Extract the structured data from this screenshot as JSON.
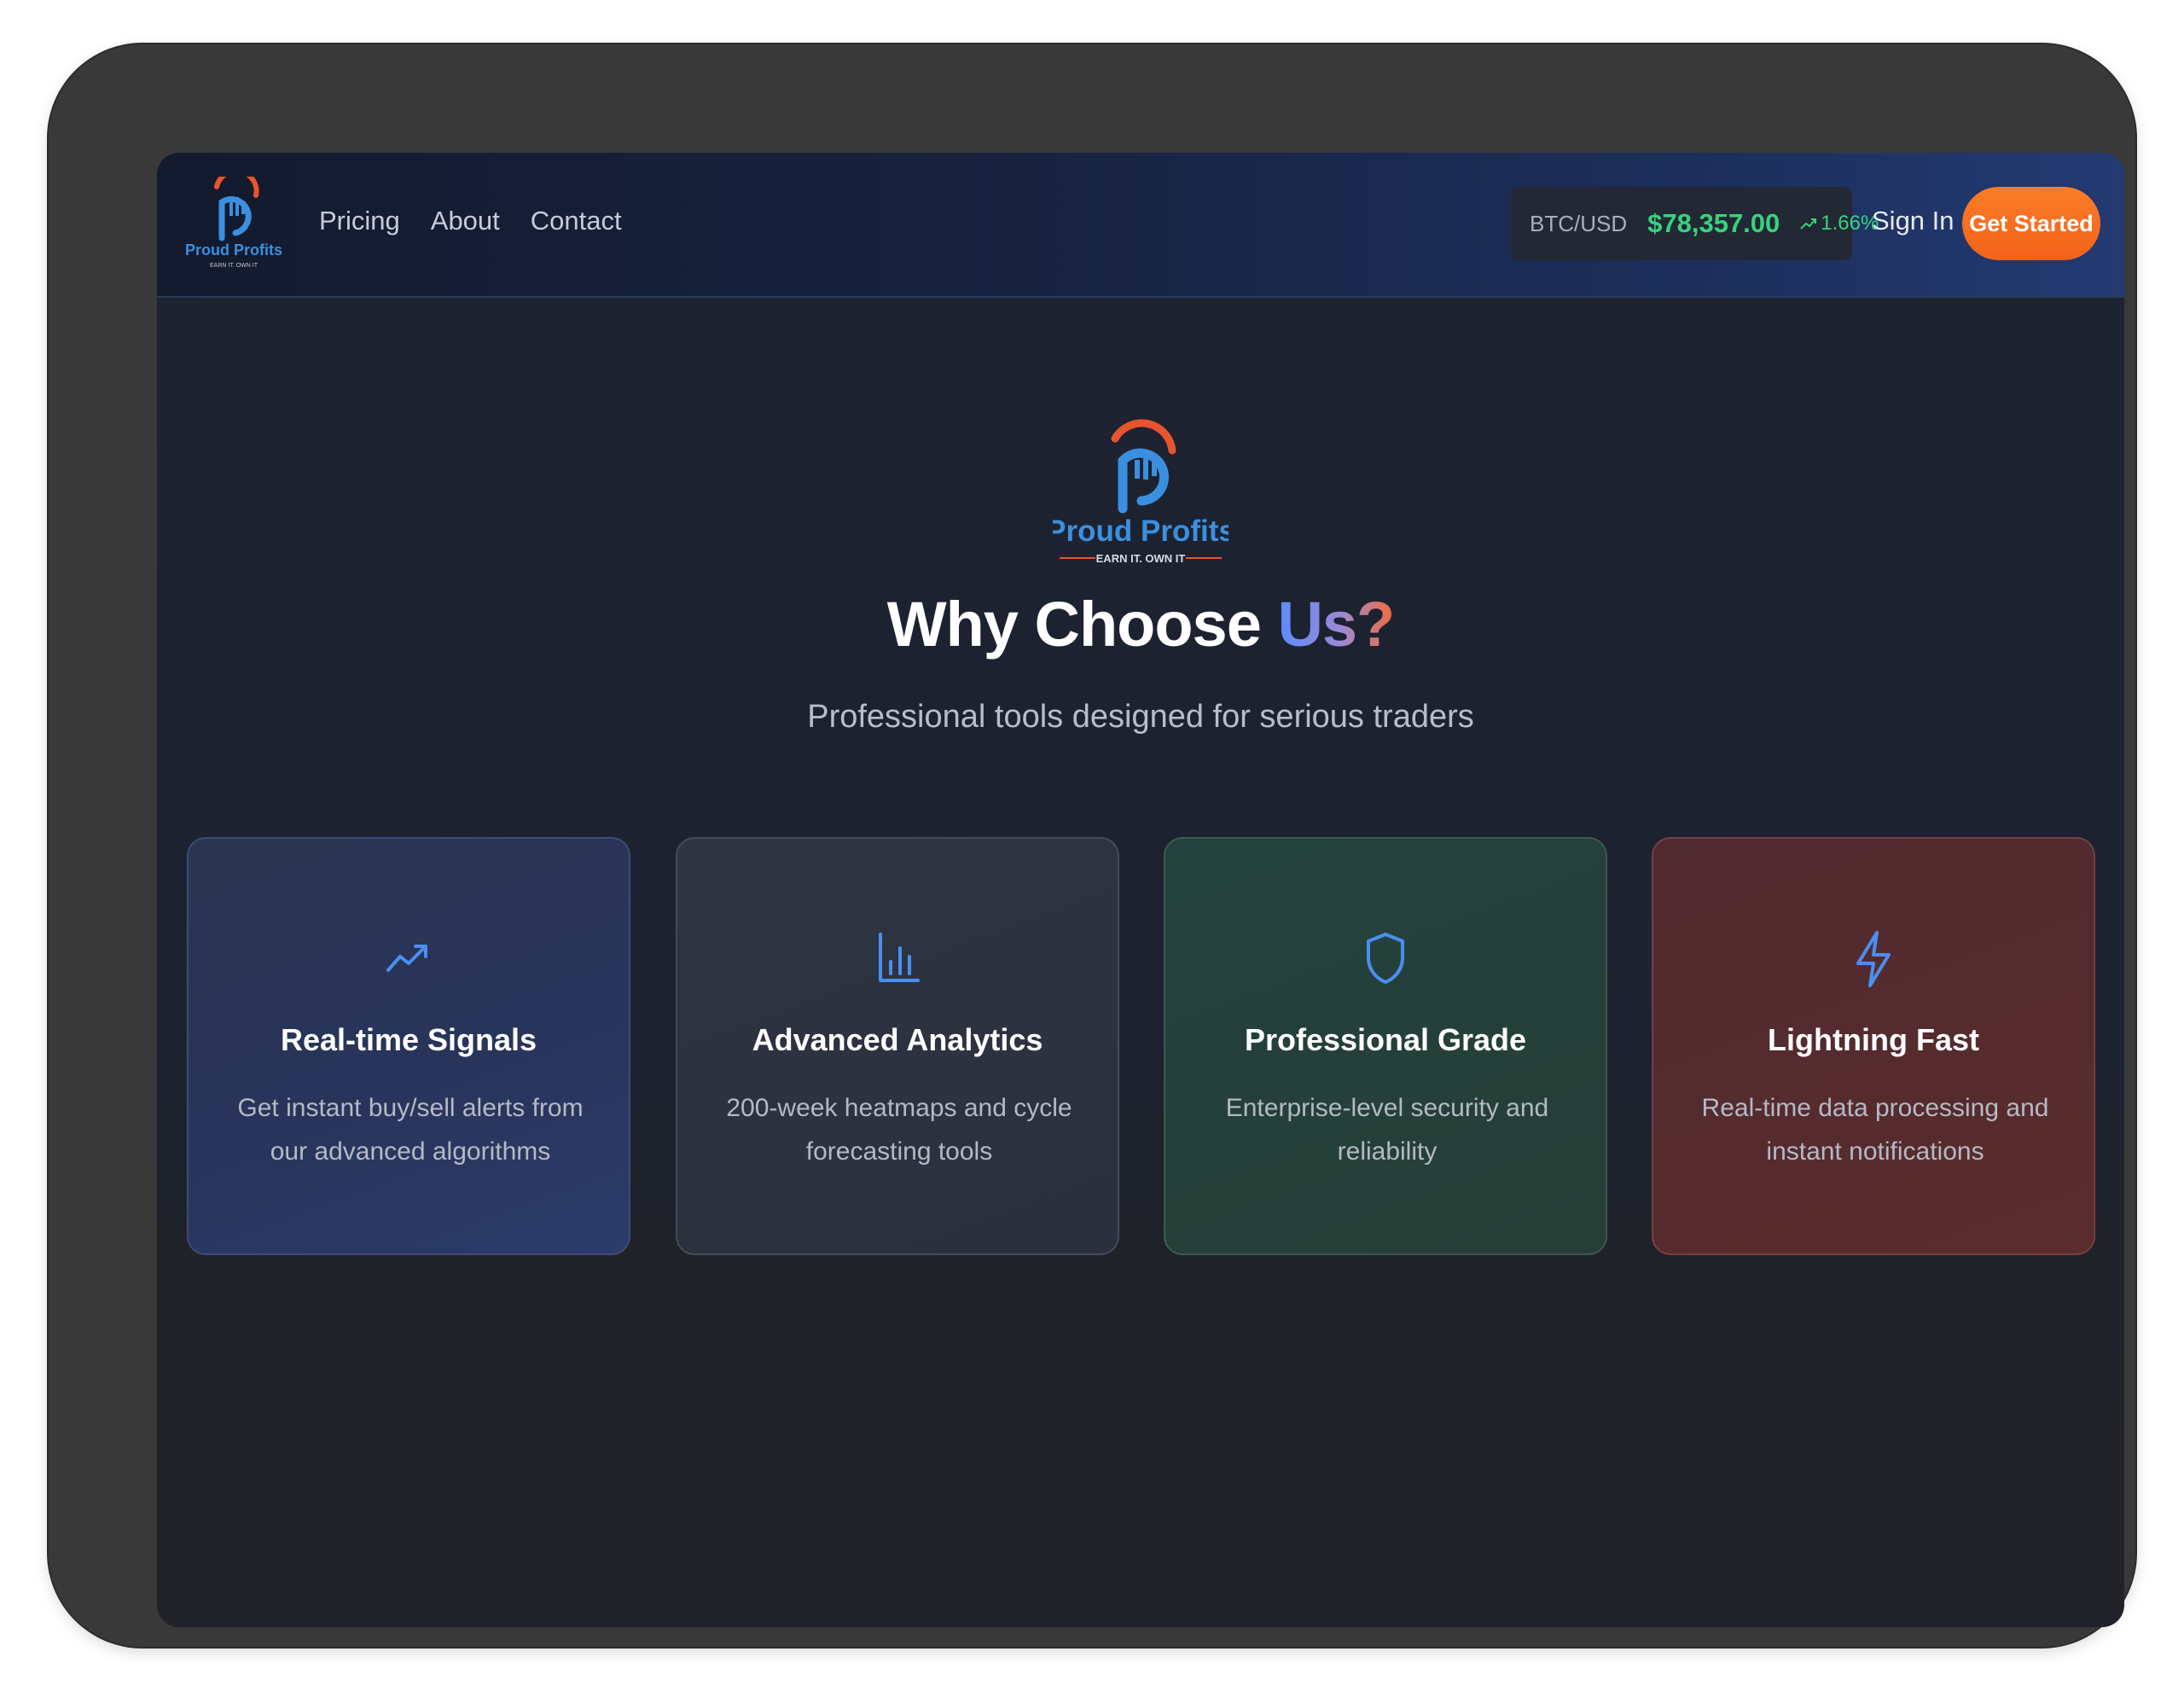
{
  "brand": {
    "name": "Proud Profits",
    "tagline": "EARN IT. OWN IT"
  },
  "nav": {
    "links": [
      "Pricing",
      "About",
      "Contact"
    ],
    "sign_in": "Sign In",
    "get_started": "Get Started"
  },
  "ticker": {
    "pair": "BTC/USD",
    "price": "$78,357.00",
    "change": "1.66%",
    "trend_icon": "trending-up-icon"
  },
  "hero": {
    "title_main": "Why Choose ",
    "title_accent": "Us?",
    "subtitle": "Professional tools designed for serious traders"
  },
  "features": [
    {
      "icon": "trending-up-icon",
      "title": "Real-time Signals",
      "description": "Get instant buy/sell alerts from our advanced algorithms"
    },
    {
      "icon": "bar-chart-icon",
      "title": "Advanced Analytics",
      "description": "200-week heatmaps and cycle forecasting tools"
    },
    {
      "icon": "shield-icon",
      "title": "Professional Grade",
      "description": "Enterprise-level security and reliability"
    },
    {
      "icon": "lightning-icon",
      "title": "Lightning Fast",
      "description": "Real-time data processing and instant notifications"
    }
  ],
  "colors": {
    "accent_orange": "#f56a1f",
    "ticker_green": "#38d27e",
    "brand_blue": "#3b8fe0",
    "icon_blue": "#4a8ff0"
  }
}
